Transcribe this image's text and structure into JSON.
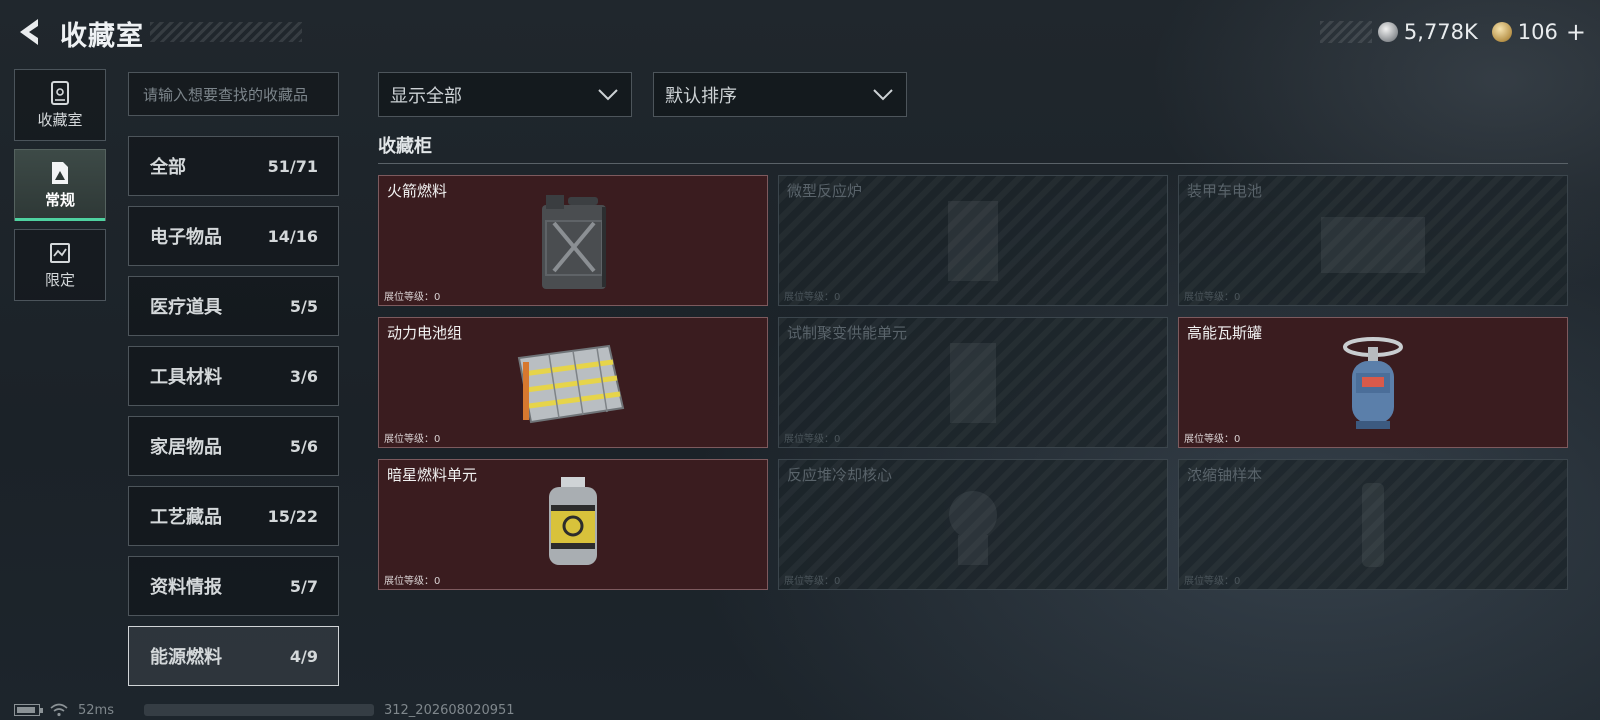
{
  "header": {
    "title": "收藏室",
    "currencies": [
      {
        "icon": "silver-coin-icon",
        "value": "5,778K"
      },
      {
        "icon": "gold-coin-icon",
        "value": "106"
      }
    ],
    "plus_label": "+"
  },
  "nav": {
    "items": [
      {
        "label": "收藏室",
        "icon": "cabinet-icon",
        "active": false
      },
      {
        "label": "常规",
        "icon": "regular-collection-icon",
        "active": true
      },
      {
        "label": "限定",
        "icon": "limited-collection-icon",
        "active": false
      }
    ]
  },
  "search": {
    "placeholder": "请输入想要查找的收藏品"
  },
  "categories": [
    {
      "name": "全部",
      "count": "51/71"
    },
    {
      "name": "电子物品",
      "count": "14/16"
    },
    {
      "name": "医疗道具",
      "count": "5/5"
    },
    {
      "name": "工具材料",
      "count": "3/6"
    },
    {
      "name": "家居物品",
      "count": "5/6"
    },
    {
      "name": "工艺藏品",
      "count": "15/22"
    },
    {
      "name": "资料情报",
      "count": "5/7"
    },
    {
      "name": "能源燃料",
      "count": "4/9",
      "selected": true
    }
  ],
  "filters": {
    "display": "显示全部",
    "sort": "默认排序"
  },
  "section": {
    "title": "收藏柜"
  },
  "items": [
    {
      "name": "火箭燃料",
      "level_text": "展位等级：0",
      "owned": true,
      "icon": "jerrycan-icon"
    },
    {
      "name": "微型反应炉",
      "level_text": "展位等级：0",
      "owned": false,
      "icon": "reactor-icon"
    },
    {
      "name": "装甲车电池",
      "level_text": "展位等级：0",
      "owned": false,
      "icon": "battery-icon"
    },
    {
      "name": "动力电池组",
      "level_text": "展位等级：0",
      "owned": true,
      "icon": "battery-pack-icon"
    },
    {
      "name": "试制聚变供能单元",
      "level_text": "展位等级：0",
      "owned": false,
      "icon": "fusion-unit-icon"
    },
    {
      "name": "高能瓦斯罐",
      "level_text": "展位等级：0",
      "owned": true,
      "icon": "gas-canister-icon"
    },
    {
      "name": "暗星燃料单元",
      "level_text": "展位等级：0",
      "owned": true,
      "icon": "fuel-cell-icon"
    },
    {
      "name": "反应堆冷却核心",
      "level_text": "展位等级：0",
      "owned": false,
      "icon": "cooling-core-icon"
    },
    {
      "name": "浓缩铀样本",
      "level_text": "展位等级：0",
      "owned": false,
      "icon": "uranium-sample-icon"
    }
  ],
  "status": {
    "ping": "52ms",
    "build": "312_202608020951"
  },
  "colors": {
    "owned_card": "#3a1c1f",
    "accent": "#4fd2a0"
  }
}
